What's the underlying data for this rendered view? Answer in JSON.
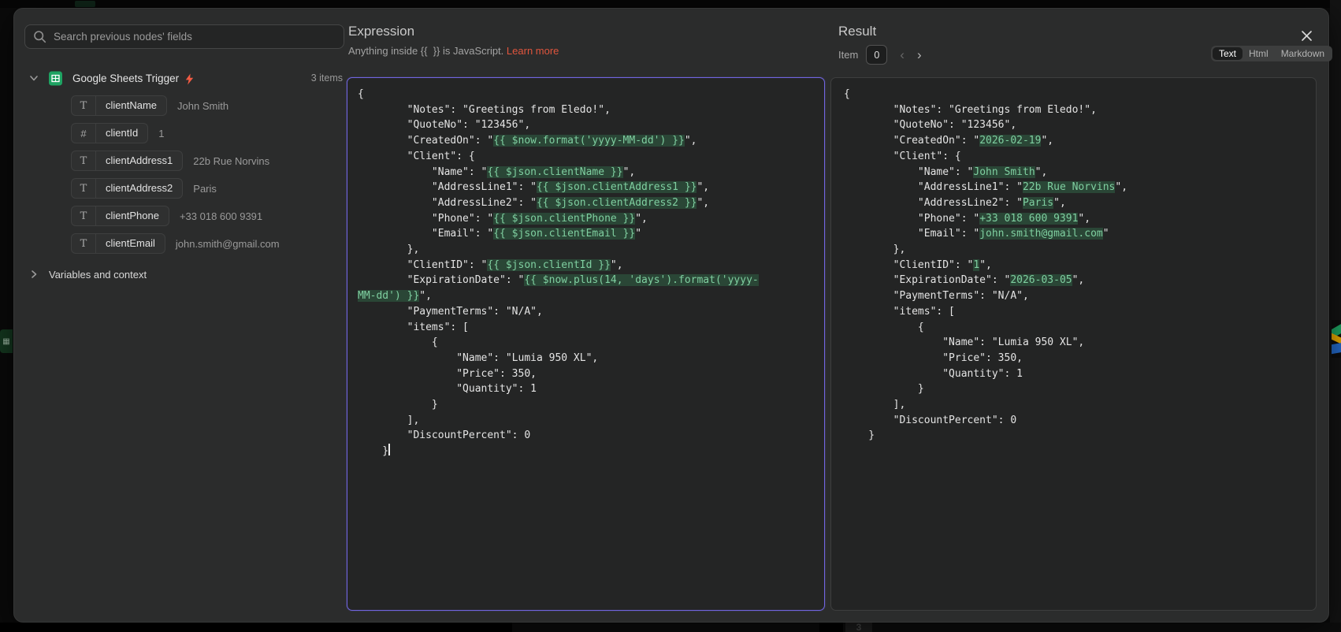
{
  "sidebar": {
    "search_placeholder": "Search previous nodes' fields",
    "node": {
      "name": "Google Sheets Trigger",
      "items_count": "3 items"
    },
    "fields": [
      {
        "type": "text",
        "name": "clientName",
        "value": "John Smith"
      },
      {
        "type": "number",
        "name": "clientId",
        "value": "1"
      },
      {
        "type": "text",
        "name": "clientAddress1",
        "value": "22b Rue Norvins"
      },
      {
        "type": "text",
        "name": "clientAddress2",
        "value": "Paris"
      },
      {
        "type": "text",
        "name": "clientPhone",
        "value": "+33 018 600 9391"
      },
      {
        "type": "text",
        "name": "clientEmail",
        "value": "john.smith@gmail.com"
      }
    ],
    "variables_label": "Variables and context"
  },
  "expression": {
    "title": "Expression",
    "subtitle_prefix": "Anything inside {{  }} is JavaScript.",
    "learn_more": "Learn more",
    "code_lines": [
      [
        {
          "t": "{"
        }
      ],
      [
        {
          "t": "        \"Notes\": \"Greetings from Eledo!\","
        }
      ],
      [
        {
          "t": "        \"QuoteNo\": \"123456\","
        }
      ],
      [
        {
          "t": "        \"CreatedOn\": \""
        },
        {
          "t": "{{ $now.format('yyyy-MM-dd') }}",
          "h": true
        },
        {
          "t": "\","
        }
      ],
      [
        {
          "t": "        \"Client\": {"
        }
      ],
      [
        {
          "t": "            \"Name\": \""
        },
        {
          "t": "{{ $json.clientName }}",
          "h": true
        },
        {
          "t": "\","
        }
      ],
      [
        {
          "t": "            \"AddressLine1\": \""
        },
        {
          "t": "{{ $json.clientAddress1 }}",
          "h": true
        },
        {
          "t": "\","
        }
      ],
      [
        {
          "t": "            \"AddressLine2\": \""
        },
        {
          "t": "{{ $json.clientAddress2 }}",
          "h": true
        },
        {
          "t": "\","
        }
      ],
      [
        {
          "t": "            \"Phone\": \""
        },
        {
          "t": "{{ $json.clientPhone }}",
          "h": true
        },
        {
          "t": "\","
        }
      ],
      [
        {
          "t": "            \"Email\": \""
        },
        {
          "t": "{{ $json.clientEmail }}",
          "h": true
        },
        {
          "t": "\""
        }
      ],
      [
        {
          "t": "        },"
        }
      ],
      [
        {
          "t": "        \"ClientID\": \""
        },
        {
          "t": "{{ $json.clientId }}",
          "h": true
        },
        {
          "t": "\","
        }
      ],
      [
        {
          "t": "        \"ExpirationDate\": \""
        },
        {
          "t": "{{ $now.plus(14, 'days').format('yyyy-",
          "h": true
        }
      ],
      [
        {
          "t": "MM-dd') }}",
          "h": true
        },
        {
          "t": "\","
        }
      ],
      [
        {
          "t": "        \"PaymentTerms\": \"N/A\","
        }
      ],
      [
        {
          "t": "        \"items\": ["
        }
      ],
      [
        {
          "t": "            {"
        }
      ],
      [
        {
          "t": "                \"Name\": \"Lumia 950 XL\","
        }
      ],
      [
        {
          "t": "                \"Price\": 350,"
        }
      ],
      [
        {
          "t": "                \"Quantity\": 1"
        }
      ],
      [
        {
          "t": "            }"
        }
      ],
      [
        {
          "t": "        ],"
        }
      ],
      [
        {
          "t": "        \"DiscountPercent\": 0"
        }
      ],
      [
        {
          "t": "    }"
        }
      ]
    ]
  },
  "result": {
    "title": "Result",
    "item_label": "Item",
    "item_index": "0",
    "modes": [
      "Text",
      "Html",
      "Markdown"
    ],
    "active_mode": "Text",
    "code_lines": [
      [
        {
          "t": "{"
        }
      ],
      [
        {
          "t": "        \"Notes\": \"Greetings from Eledo!\","
        }
      ],
      [
        {
          "t": "        \"QuoteNo\": \"123456\","
        }
      ],
      [
        {
          "t": "        \"CreatedOn\": \""
        },
        {
          "t": "2026-02-19",
          "h": true
        },
        {
          "t": "\","
        }
      ],
      [
        {
          "t": "        \"Client\": {"
        }
      ],
      [
        {
          "t": "            \"Name\": \""
        },
        {
          "t": "John Smith",
          "h": true
        },
        {
          "t": "\","
        }
      ],
      [
        {
          "t": "            \"AddressLine1\": \""
        },
        {
          "t": "22b Rue Norvins",
          "h": true
        },
        {
          "t": "\","
        }
      ],
      [
        {
          "t": "            \"AddressLine2\": \""
        },
        {
          "t": "Paris",
          "h": true
        },
        {
          "t": "\","
        }
      ],
      [
        {
          "t": "            \"Phone\": \""
        },
        {
          "t": "+33 018 600 9391",
          "h": true
        },
        {
          "t": "\","
        }
      ],
      [
        {
          "t": "            \"Email\": \""
        },
        {
          "t": "john.smith@gmail.com",
          "h": true
        },
        {
          "t": "\""
        }
      ],
      [
        {
          "t": "        },"
        }
      ],
      [
        {
          "t": "        \"ClientID\": \""
        },
        {
          "t": "1",
          "h": true
        },
        {
          "t": "\","
        }
      ],
      [
        {
          "t": "        \"ExpirationDate\": \""
        },
        {
          "t": "2026-03-05",
          "h": true
        },
        {
          "t": "\","
        }
      ],
      [
        {
          "t": "        \"PaymentTerms\": \"N/A\","
        }
      ],
      [
        {
          "t": "        \"items\": ["
        }
      ],
      [
        {
          "t": "            {"
        }
      ],
      [
        {
          "t": "                \"Name\": \"Lumia 950 XL\","
        }
      ],
      [
        {
          "t": "                \"Price\": 350,"
        }
      ],
      [
        {
          "t": "                \"Quantity\": 1"
        }
      ],
      [
        {
          "t": "            }"
        }
      ],
      [
        {
          "t": "        ],"
        }
      ],
      [
        {
          "t": "        \"DiscountPercent\": 0"
        }
      ],
      [
        {
          "t": "    }"
        }
      ]
    ]
  },
  "background": {
    "bottom_badge": "3"
  },
  "colors": {
    "accent_purple": "#7166e0",
    "expr_green_text": "#7fcfa0",
    "expr_green_bg": "#2a4636",
    "link_orange": "#e0553d",
    "bolt_orange": "#f25b43",
    "sheets_green": "#1ea362"
  }
}
